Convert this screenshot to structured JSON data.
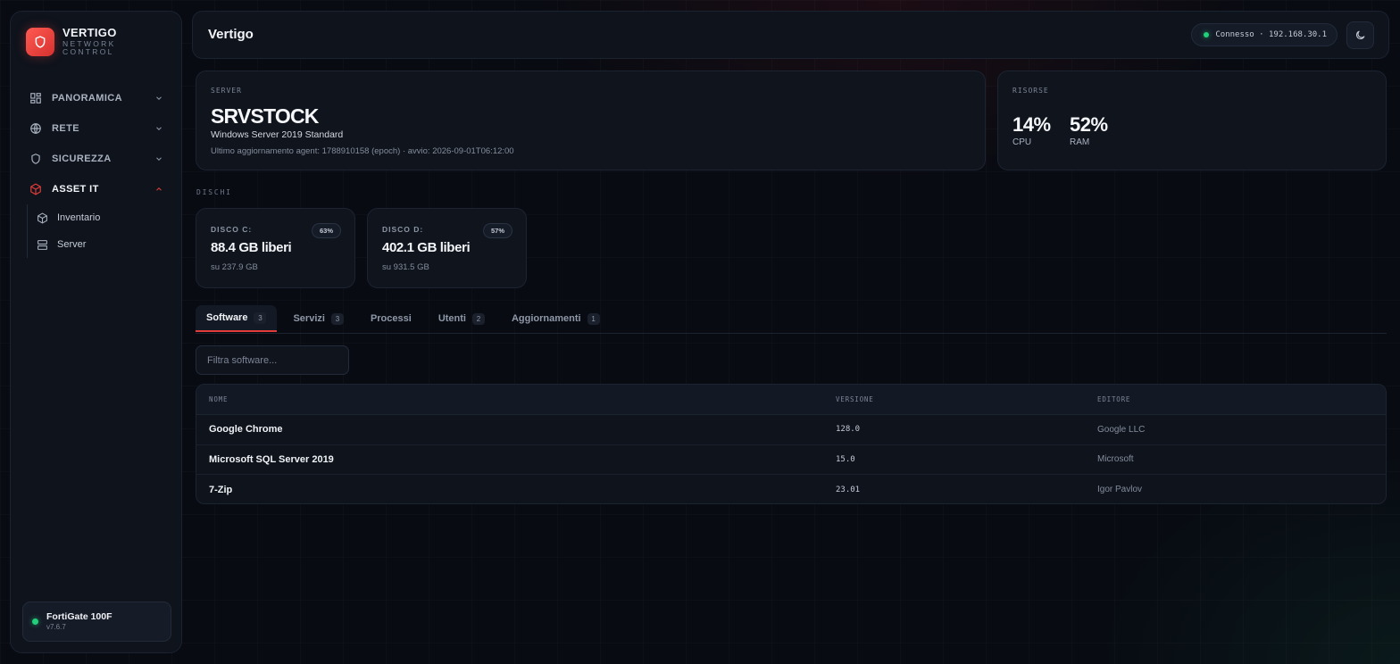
{
  "brand": {
    "name": "VERTIGO",
    "sub_line1": "NETWORK",
    "sub_line2": "CONTROL"
  },
  "sidebar": {
    "items": [
      {
        "label": "PANORAMICA",
        "icon": "dashboard-icon",
        "expanded": false
      },
      {
        "label": "RETE",
        "icon": "globe-icon",
        "expanded": false
      },
      {
        "label": "SICUREZZA",
        "icon": "shield-icon",
        "expanded": false
      },
      {
        "label": "ASSET IT",
        "icon": "cube-icon",
        "expanded": true
      }
    ],
    "subitems": [
      {
        "label": "Inventario",
        "icon": "cube-icon"
      },
      {
        "label": "Server",
        "icon": "server-icon"
      }
    ],
    "device": {
      "name": "FortiGate 100F",
      "version": "v7.6.7",
      "status": "online"
    }
  },
  "header": {
    "title": "Vertigo",
    "connection": "Connesso · 192.168.30.1",
    "theme_icon": "moon-icon"
  },
  "server": {
    "label": "SERVER",
    "name": "SRVSTOCK",
    "os": "Windows Server 2019 Standard",
    "meta": "Ultimo aggiornamento agent: 1788910158 (epoch) · avvio: 2026-09-01T06:12:00"
  },
  "resources": {
    "label": "RISORSE",
    "cpu_value": "14%",
    "cpu_label": "CPU",
    "ram_value": "52%",
    "ram_label": "RAM"
  },
  "disks": {
    "label": "DISCHI",
    "items": [
      {
        "label": "DISCO C:",
        "free": "88.4 GB liberi",
        "total": "su 237.9 GB",
        "percent": "63%"
      },
      {
        "label": "DISCO D:",
        "free": "402.1 GB liberi",
        "total": "su 931.5 GB",
        "percent": "57%"
      }
    ]
  },
  "tabs": [
    {
      "label": "Software",
      "count": "3",
      "active": true
    },
    {
      "label": "Servizi",
      "count": "3",
      "active": false
    },
    {
      "label": "Processi",
      "count": null,
      "active": false
    },
    {
      "label": "Utenti",
      "count": "2",
      "active": false
    },
    {
      "label": "Aggiornamenti",
      "count": "1",
      "active": false
    }
  ],
  "filter": {
    "placeholder": "Filtra software..."
  },
  "table": {
    "headers": [
      "NOME",
      "VERSIONE",
      "EDITORE"
    ],
    "rows": [
      {
        "name": "Google Chrome",
        "version": "128.0",
        "publisher": "Google LLC"
      },
      {
        "name": "Microsoft SQL Server 2019",
        "version": "15.0",
        "publisher": "Microsoft"
      },
      {
        "name": "7-Zip",
        "version": "23.01",
        "publisher": "Igor Pavlov"
      }
    ]
  },
  "colors": {
    "accent": "#e23c3a",
    "online": "#22d07a",
    "bg": "#080b12",
    "panel": "#0e131c"
  }
}
